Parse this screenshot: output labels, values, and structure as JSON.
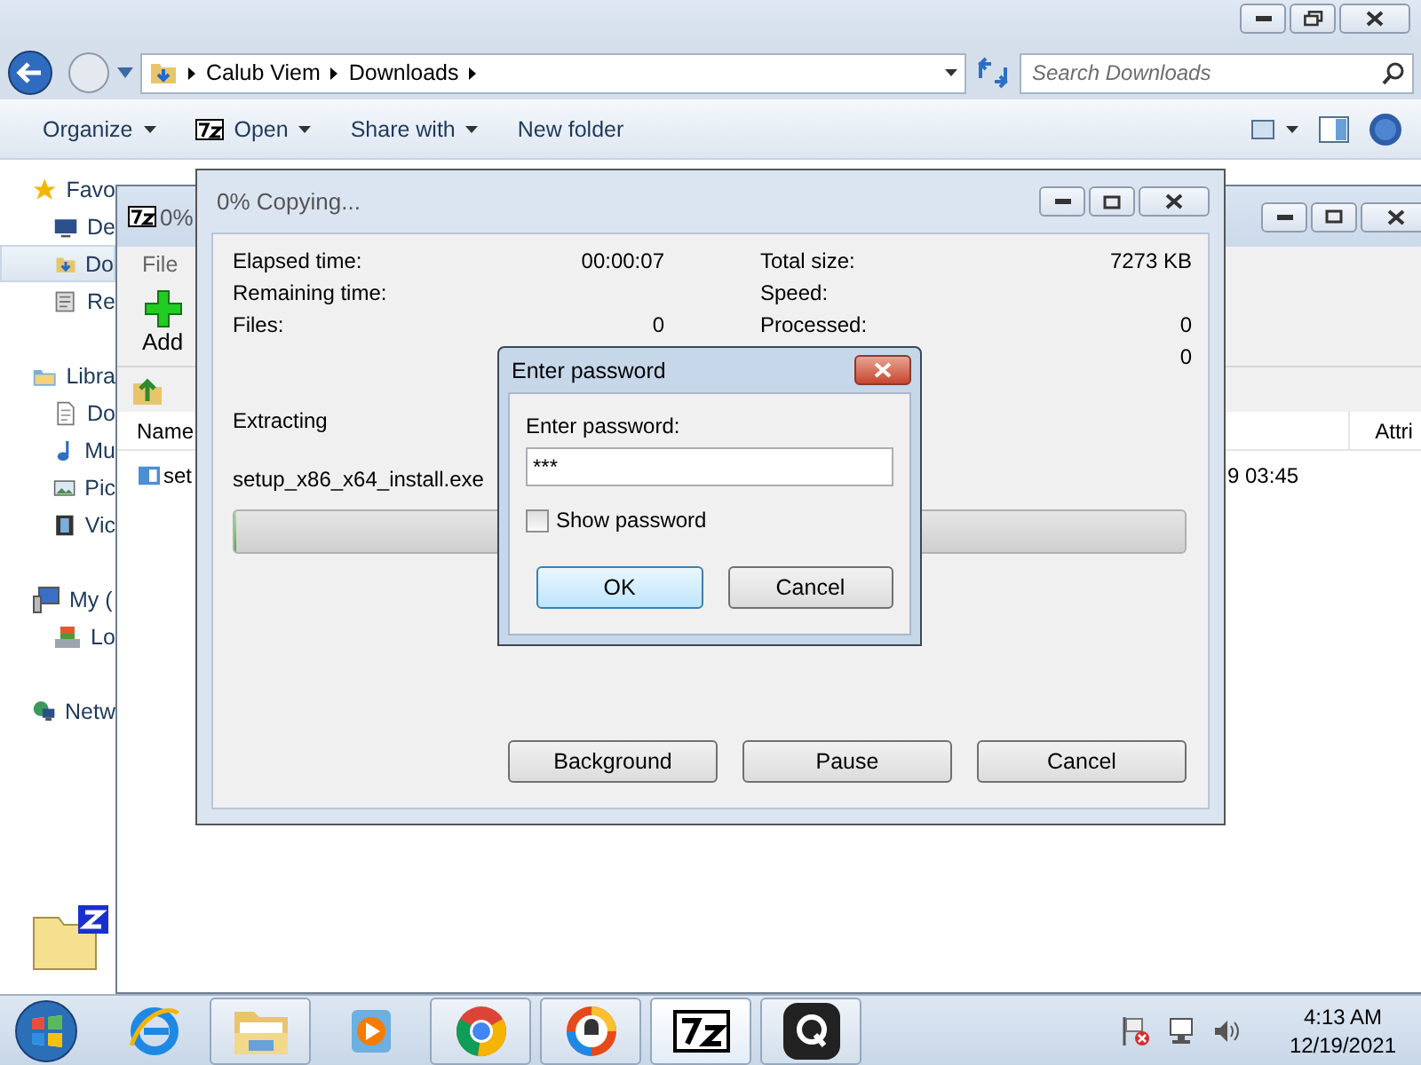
{
  "explorer": {
    "breadcrumb": [
      "Calub Viem",
      "Downloads"
    ],
    "search": {
      "placeholder": "Search Downloads"
    },
    "toolbar": [
      {
        "label": "Organize",
        "kind": "menu"
      },
      {
        "label": "Open",
        "kind": "sevenzip-menu"
      },
      {
        "label": "Share with",
        "kind": "menu"
      },
      {
        "label": "New folder",
        "kind": "plain"
      }
    ],
    "nav": [
      {
        "label": "Favo",
        "kind": "star",
        "selected": false,
        "children": [
          {
            "label": "De",
            "kind": "desktop",
            "selected": false
          },
          {
            "label": "Do",
            "kind": "downloads",
            "selected": true
          },
          {
            "label": "Re",
            "kind": "recent",
            "selected": false
          }
        ]
      },
      {
        "label": "Libra",
        "kind": "library",
        "selected": false,
        "children": [
          {
            "label": "Do",
            "kind": "document",
            "selected": false
          },
          {
            "label": "Mu",
            "kind": "music",
            "selected": false
          },
          {
            "label": "Pic",
            "kind": "pictures",
            "selected": false
          },
          {
            "label": "Vic",
            "kind": "video",
            "selected": false
          }
        ]
      },
      {
        "label": "My (",
        "kind": "computer",
        "selected": false,
        "children": [
          {
            "label": "Lo",
            "kind": "disk",
            "selected": false
          }
        ]
      },
      {
        "label": "Netw",
        "kind": "network",
        "selected": false
      }
    ]
  },
  "sevenzip": {
    "title": "0%",
    "menu": [
      "File"
    ],
    "toolbar": [
      "Add"
    ],
    "columns": [
      "Name",
      "Attri"
    ],
    "rows": [
      {
        "name": "set",
        "column_2": "9 03:45"
      }
    ]
  },
  "copying": {
    "title": "0% Copying...",
    "stats_left": [
      {
        "label": "Elapsed time:",
        "value": "00:00:07"
      },
      {
        "label": "Remaining time:"
      },
      {
        "label": "Files:",
        "value": "0"
      }
    ],
    "stats_right": [
      {
        "label": "Total size:",
        "value": "7273 KB"
      },
      {
        "label": "Speed:"
      },
      {
        "label": "Processed:",
        "value": "0"
      },
      {
        "value": "0"
      }
    ],
    "status": "Extracting",
    "file": "setup_x86_x64_install.exe",
    "progress": {
      "level": 0
    },
    "buttons": [
      "Background",
      "Pause",
      "Cancel"
    ]
  },
  "password_dialog": {
    "title": "Enter password",
    "label": "Enter password:",
    "value": "***",
    "show_password": {
      "label": "Show password",
      "checked": false
    },
    "buttons": [
      {
        "label": "OK",
        "focused": true
      },
      {
        "label": "Cancel",
        "focused": false
      }
    ]
  },
  "taskbar": {
    "apps": [
      {
        "kind": "ie",
        "running": false,
        "selected": false
      },
      {
        "kind": "explorer",
        "running": true,
        "selected": false
      },
      {
        "kind": "media",
        "running": false,
        "selected": false
      },
      {
        "kind": "chrome",
        "running": true,
        "selected": false
      },
      {
        "kind": "shield-browser",
        "running": true,
        "selected": false
      },
      {
        "kind": "sevenzip",
        "running": true,
        "selected": true
      },
      {
        "kind": "q",
        "running": true,
        "selected": false
      }
    ],
    "time": "4:13 AM",
    "date": "12/19/2021"
  }
}
